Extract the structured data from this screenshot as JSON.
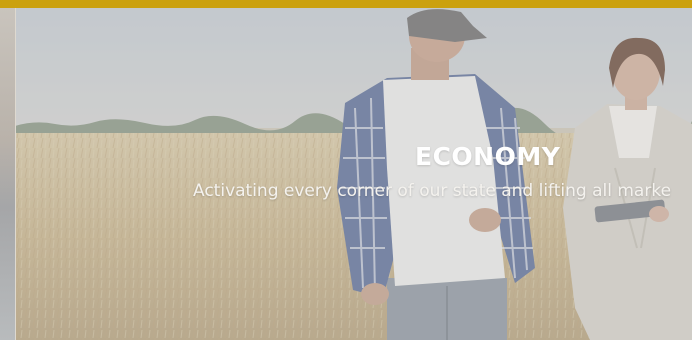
{
  "header": {
    "accent_color": "#cba10f"
  },
  "carousel": {
    "active_slide": {
      "title": "ECONOMY",
      "subtitle": "Activating every corner of our state and lifting all marke",
      "image": "farmers-in-wheat-field-photo"
    }
  }
}
